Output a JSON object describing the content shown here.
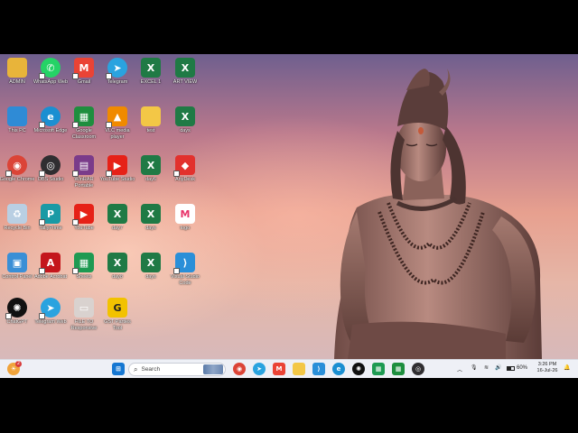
{
  "desktop_icons": [
    {
      "label": "ADMIN",
      "icon": "user-folder-icon",
      "color": "#e8b43a",
      "glyph": ""
    },
    {
      "label": "WhatsApp Web",
      "icon": "whatsapp-icon",
      "color": "#25d366",
      "glyph": "✆"
    },
    {
      "label": "Gmail",
      "icon": "gmail-icon",
      "color": "#ea4335",
      "glyph": "M"
    },
    {
      "label": "Telegram",
      "icon": "telegram-icon",
      "color": "#2aa3df",
      "glyph": "➤"
    },
    {
      "label": "EXCEL 1",
      "icon": "excel-icon",
      "color": "#1f7a45",
      "glyph": "X"
    },
    {
      "label": "ART VIEW",
      "icon": "excel-icon",
      "color": "#1f7a45",
      "glyph": "X"
    },
    {
      "label": "This PC",
      "icon": "monitor-icon",
      "color": "#2f8bd6",
      "glyph": ""
    },
    {
      "label": "Microsoft Edge",
      "icon": "edge-icon",
      "color": "#1b8fd1",
      "glyph": "e"
    },
    {
      "label": "Google Classroom",
      "icon": "classroom-icon",
      "color": "#1e8e3e",
      "glyph": "▦"
    },
    {
      "label": "VLC media player",
      "icon": "vlc-cone-icon",
      "color": "#f08a00",
      "glyph": "▲"
    },
    {
      "label": "test",
      "icon": "folder-icon",
      "color": "#f3c746",
      "glyph": ""
    },
    {
      "label": "days",
      "icon": "excel-icon",
      "color": "#1f7a45",
      "glyph": "X"
    },
    {
      "label": "Google Chrome",
      "icon": "chrome-icon",
      "color": "#db4437",
      "glyph": "◉"
    },
    {
      "label": "OBS Studio",
      "icon": "obs-icon",
      "color": "#302e31",
      "glyph": "◎"
    },
    {
      "label": "WinRAR Portable",
      "icon": "winrar-icon",
      "color": "#7a3b8a",
      "glyph": "▤"
    },
    {
      "label": "YouTube Studio",
      "icon": "youtube-icon",
      "color": "#e62117",
      "glyph": "▶"
    },
    {
      "label": "day6",
      "icon": "excel-icon",
      "color": "#1f7a45",
      "glyph": "X"
    },
    {
      "label": "AnyDesk",
      "icon": "anydesk-icon",
      "color": "#e2312d",
      "glyph": "◆"
    },
    {
      "label": "Recycle Bin",
      "icon": "recycle-bin-icon",
      "color": "#b9cfe3",
      "glyph": "♻"
    },
    {
      "label": "TallyPrime",
      "icon": "tally-icon",
      "color": "#1a9aa5",
      "glyph": "P"
    },
    {
      "label": "YouTube",
      "icon": "youtube-icon",
      "color": "#e62117",
      "glyph": "▶"
    },
    {
      "label": "day7",
      "icon": "excel-icon",
      "color": "#1f7a45",
      "glyph": "X"
    },
    {
      "label": "days",
      "icon": "excel-icon",
      "color": "#1f7a45",
      "glyph": "X"
    },
    {
      "label": "logo",
      "icon": "myntra-logo-icon",
      "color": "#ffffff",
      "glyph": "M"
    },
    {
      "label": "Control Panel",
      "icon": "control-panel-icon",
      "color": "#3a8fd6",
      "glyph": "▣"
    },
    {
      "label": "Adobe Acrobat",
      "icon": "acrobat-icon",
      "color": "#c4161c",
      "glyph": "A"
    },
    {
      "label": "Sheets",
      "icon": "sheets-icon",
      "color": "#1e9a52",
      "glyph": "▦"
    },
    {
      "label": "day8",
      "icon": "excel-icon",
      "color": "#1f7a45",
      "glyph": "X"
    },
    {
      "label": "days",
      "icon": "excel-icon",
      "color": "#1f7a45",
      "glyph": "X"
    },
    {
      "label": "Visual Studio Code",
      "icon": "vscode-icon",
      "color": "#2a8fd8",
      "glyph": "⟩"
    },
    {
      "label": "ChatGPT",
      "icon": "chatgpt-icon",
      "color": "#111111",
      "glyph": "✺"
    },
    {
      "label": "Telegram Web",
      "icon": "telegram-icon",
      "color": "#2aa3df",
      "glyph": "➤"
    },
    {
      "label": "FILE TO Responsive",
      "icon": "file-thumbnail-icon",
      "color": "#d9d2cf",
      "glyph": "▭"
    },
    {
      "label": "GST Parties Tool",
      "icon": "gst-tool-icon",
      "color": "#f2c200",
      "glyph": "G"
    }
  ],
  "taskbar": {
    "search_placeholder": "Search",
    "notification_count": "2",
    "tray": {
      "battery": "60%"
    },
    "clock": {
      "time": "3:26 PM",
      "date": "16-Jul-26"
    }
  },
  "taskbar_apps": [
    {
      "name": "start-button",
      "icon": "windows-logo-icon",
      "color": "#1677d2",
      "glyph": "⊞"
    },
    {
      "name": "chrome",
      "icon": "chrome-icon",
      "color": "#db4437",
      "glyph": "◉"
    },
    {
      "name": "telegram",
      "icon": "telegram-icon",
      "color": "#2aa3df",
      "glyph": "➤"
    },
    {
      "name": "gmail",
      "icon": "gmail-icon",
      "color": "#ea4335",
      "glyph": "M"
    },
    {
      "name": "file-explorer",
      "icon": "folder-icon",
      "color": "#f3c746",
      "glyph": ""
    },
    {
      "name": "vscode",
      "icon": "vscode-icon",
      "color": "#2a8fd8",
      "glyph": "⟩"
    },
    {
      "name": "edge",
      "icon": "edge-icon",
      "color": "#1b8fd1",
      "glyph": "e"
    },
    {
      "name": "chatgpt",
      "icon": "chatgpt-icon",
      "color": "#111111",
      "glyph": "✺"
    },
    {
      "name": "sheets",
      "icon": "sheets-icon",
      "color": "#1e9a52",
      "glyph": "▦"
    },
    {
      "name": "classroom",
      "icon": "classroom-icon",
      "color": "#1e8e3e",
      "glyph": "▦"
    },
    {
      "name": "obs",
      "icon": "obs-icon",
      "color": "#302e31",
      "glyph": "◎"
    }
  ]
}
